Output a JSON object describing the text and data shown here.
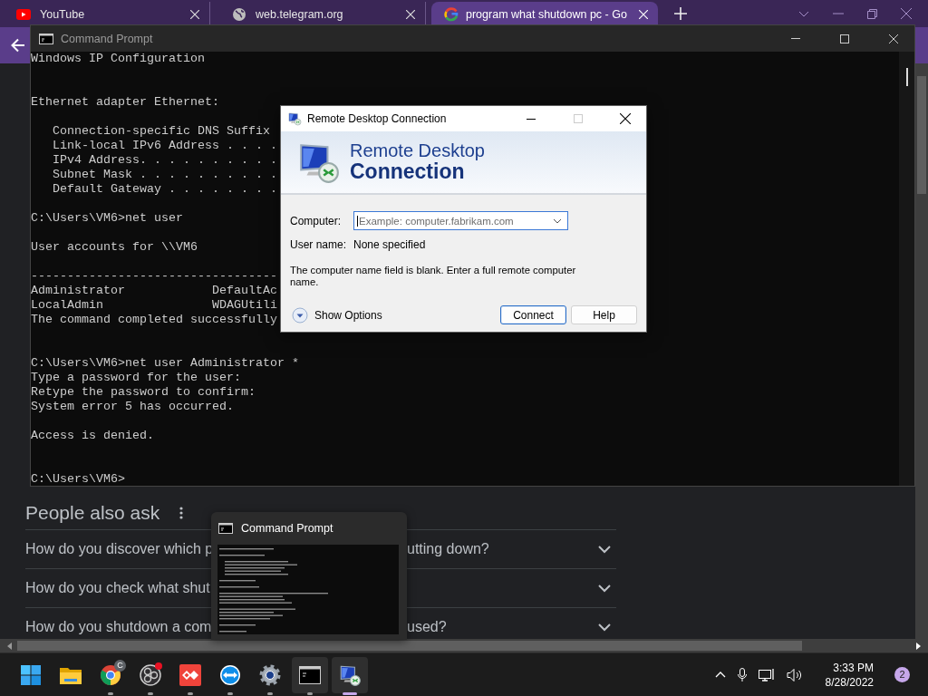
{
  "browser": {
    "tabs": [
      {
        "title": "YouTube",
        "selected": false
      },
      {
        "title": "web.telegram.org",
        "selected": false
      },
      {
        "title": "program what shutdown pc - Go",
        "selected": true
      }
    ],
    "people_also_ask": {
      "heading": "People also ask",
      "questions": [
        {
          "text": "How do you discover which p",
          "text_end": "utting down?"
        },
        {
          "text": "How do you check what shut"
        },
        {
          "text": "How do you shutdown a com",
          "text_end": "used?"
        }
      ]
    }
  },
  "console": {
    "title": "Command Prompt",
    "lines": [
      {
        "kind": "text",
        "text": "Windows IP Configuration"
      },
      {
        "kind": "blank"
      },
      {
        "kind": "blank"
      },
      {
        "kind": "text",
        "text": "Ethernet adapter Ethernet:"
      },
      {
        "kind": "blank"
      },
      {
        "kind": "text",
        "text": "   Connection-specific DNS Suffix"
      },
      {
        "kind": "text",
        "text": "   Link-local IPv6 Address . . . ."
      },
      {
        "kind": "text",
        "text": "   IPv4 Address. . . . . . . . . ."
      },
      {
        "kind": "text",
        "text": "   Subnet Mask . . . . . . . . . ."
      },
      {
        "kind": "text",
        "text": "   Default Gateway . . . . . . . ."
      },
      {
        "kind": "blank"
      },
      {
        "kind": "text",
        "text": "C:\\Users\\VM6>net user"
      },
      {
        "kind": "blank"
      },
      {
        "kind": "text",
        "text": "User accounts for \\\\VM6"
      },
      {
        "kind": "blank"
      },
      {
        "kind": "text",
        "text": "----------------------------------"
      },
      {
        "kind": "text",
        "text": "Administrator            DefaultAc"
      },
      {
        "kind": "text",
        "text": "LocalAdmin               WDAGUtili"
      },
      {
        "kind": "text",
        "text": "The command completed successfully"
      },
      {
        "kind": "blank"
      },
      {
        "kind": "blank"
      },
      {
        "kind": "text",
        "text": "C:\\Users\\VM6>net user Administrator *"
      },
      {
        "kind": "text",
        "text": "Type a password for the user:"
      },
      {
        "kind": "text",
        "text": "Retype the password to confirm:"
      },
      {
        "kind": "text",
        "text": "System error 5 has occurred."
      },
      {
        "kind": "blank"
      },
      {
        "kind": "text",
        "text": "Access is denied."
      },
      {
        "kind": "blank"
      },
      {
        "kind": "blank"
      },
      {
        "kind": "text",
        "text": "C:\\Users\\VM6>"
      }
    ]
  },
  "remote_desktop": {
    "title": "Remote Desktop Connection",
    "banner_title": "Remote Desktop",
    "banner_subtitle": "Connection",
    "computer_label": "Computer:",
    "computer_placeholder": "Example: computer.fabrikam.com",
    "username_label": "User name:",
    "username_value": "None specified",
    "message": "The computer name field is blank. Enter a full remote computer name.",
    "show_options": "Show Options",
    "buttons": [
      {
        "label": "Connect",
        "default": true
      },
      {
        "label": "Help",
        "default": false
      }
    ]
  },
  "taskbar_preview": {
    "title": "Command Prompt"
  },
  "taskbar": {
    "apps": [
      {
        "kind": "start",
        "running": false,
        "selected": false,
        "hovered": false
      },
      {
        "kind": "explorer",
        "running": false,
        "selected": false,
        "hovered": false
      },
      {
        "kind": "chrome",
        "running": true,
        "selected": false,
        "hovered": false,
        "badge": "C"
      },
      {
        "kind": "obs",
        "running": true,
        "selected": false,
        "hovered": false,
        "alert": true
      },
      {
        "kind": "anydesk",
        "running": true,
        "selected": false,
        "hovered": false
      },
      {
        "kind": "teamviewer",
        "running": true,
        "selected": false,
        "hovered": false
      },
      {
        "kind": "settings",
        "running": true,
        "selected": false,
        "hovered": false
      },
      {
        "kind": "cmd",
        "running": true,
        "selected": false,
        "hovered": true
      },
      {
        "kind": "rdp",
        "running": true,
        "selected": true,
        "hovered": false
      }
    ],
    "time": "3:33 PM",
    "date": "8/28/2022",
    "notifications": "2"
  }
}
